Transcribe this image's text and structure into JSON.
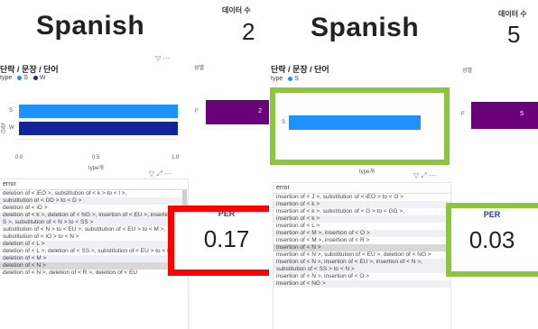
{
  "left": {
    "language": "Spanish",
    "count_label": "데이터 수",
    "count_value": "2",
    "chart_title": "단락 / 문장 / 단어",
    "legend_title": "type",
    "legend_items": [
      "S",
      "W"
    ],
    "ticks": [
      "0.0",
      "0.5",
      "1.0"
    ],
    "axis_label": "type개",
    "y_axis_label": "단락",
    "gender_label": "성별",
    "gender_category": "F",
    "gender_value": "2",
    "table_header": "error",
    "rows": [
      "deletion of < iEO >, substitution of < k > to < l >,",
      "substitution of < DD > to < D >",
      "deletion of < iO >",
      "deletion of < k >, deletion of < NG >, insertion of < EU >, insertion of < S >, substitution of < N > to < SS >",
      "substitution of < N > to < EU >, substitution of < EU > to < M >, substitution of < iO > to < N >",
      "deletion of < L >",
      "deletion of < L >, deletion of < SS >, substitution of < EU > to < R >",
      "deletion of < M >",
      "deletion of < N >",
      "deletion of < N >, deletion of < R >, deletion of < EU"
    ],
    "per_label": "PER",
    "per_value": "0.17"
  },
  "right": {
    "language": "Spanish",
    "count_label": "데이터 수",
    "count_value": "5",
    "chart_title": "단락 / 문장 / 단어",
    "legend_title": "type",
    "legend_items": [
      "S"
    ],
    "axis_label": "type개",
    "gender_label": "성별",
    "gender_category": "F",
    "gender_value": "5",
    "table_header": "error",
    "rows": [
      "insertion of < J >, substitution of < iEO > to < O >",
      "insertion of < k >",
      "insertion of < k >, substitution of < G > to < GG >,",
      "insertion of < k >",
      "insertion of < L >",
      "insertion of < M >, insertion of < O >",
      "insertion of < M >, insertion of < R >",
      "insertion of < N >",
      "insertion of < N >, substitution of < EU >, deletion of < NG >",
      "insertion of < N >, insertion of < EU >, insertion of < N >, substitution of < SS > to < N >",
      "insertion of < N >, insertion of < O >",
      "insertion of < NG >"
    ],
    "per_label": "PER",
    "per_value": "0.03"
  },
  "colors": {
    "bar_S": "#1e90ff",
    "bar_W": "#12239e",
    "gender_bar": "#6b007b",
    "per_label": "#2a3a9a",
    "highlight_red": "#ff0000",
    "highlight_green": "#8cc63f"
  },
  "chart_data": [
    {
      "type": "bar",
      "orientation": "horizontal",
      "title": "단락 / 문장 / 단어",
      "categories": [
        "S",
        "W"
      ],
      "values": [
        1,
        1
      ],
      "xlabel": "type개",
      "ylabel": "단락",
      "xlim": [
        0,
        1
      ],
      "legend": [
        "S",
        "W"
      ]
    },
    {
      "type": "bar",
      "orientation": "horizontal",
      "title": "단락 / 문장 / 단어",
      "categories": [
        "S"
      ],
      "values": [
        1
      ],
      "xlabel": "type개",
      "legend": [
        "S"
      ]
    },
    {
      "type": "bar",
      "orientation": "horizontal",
      "title": "성별",
      "categories": [
        "F"
      ],
      "values": [
        2
      ]
    },
    {
      "type": "bar",
      "orientation": "horizontal",
      "title": "성별",
      "categories": [
        "F"
      ],
      "values": [
        5
      ]
    }
  ]
}
